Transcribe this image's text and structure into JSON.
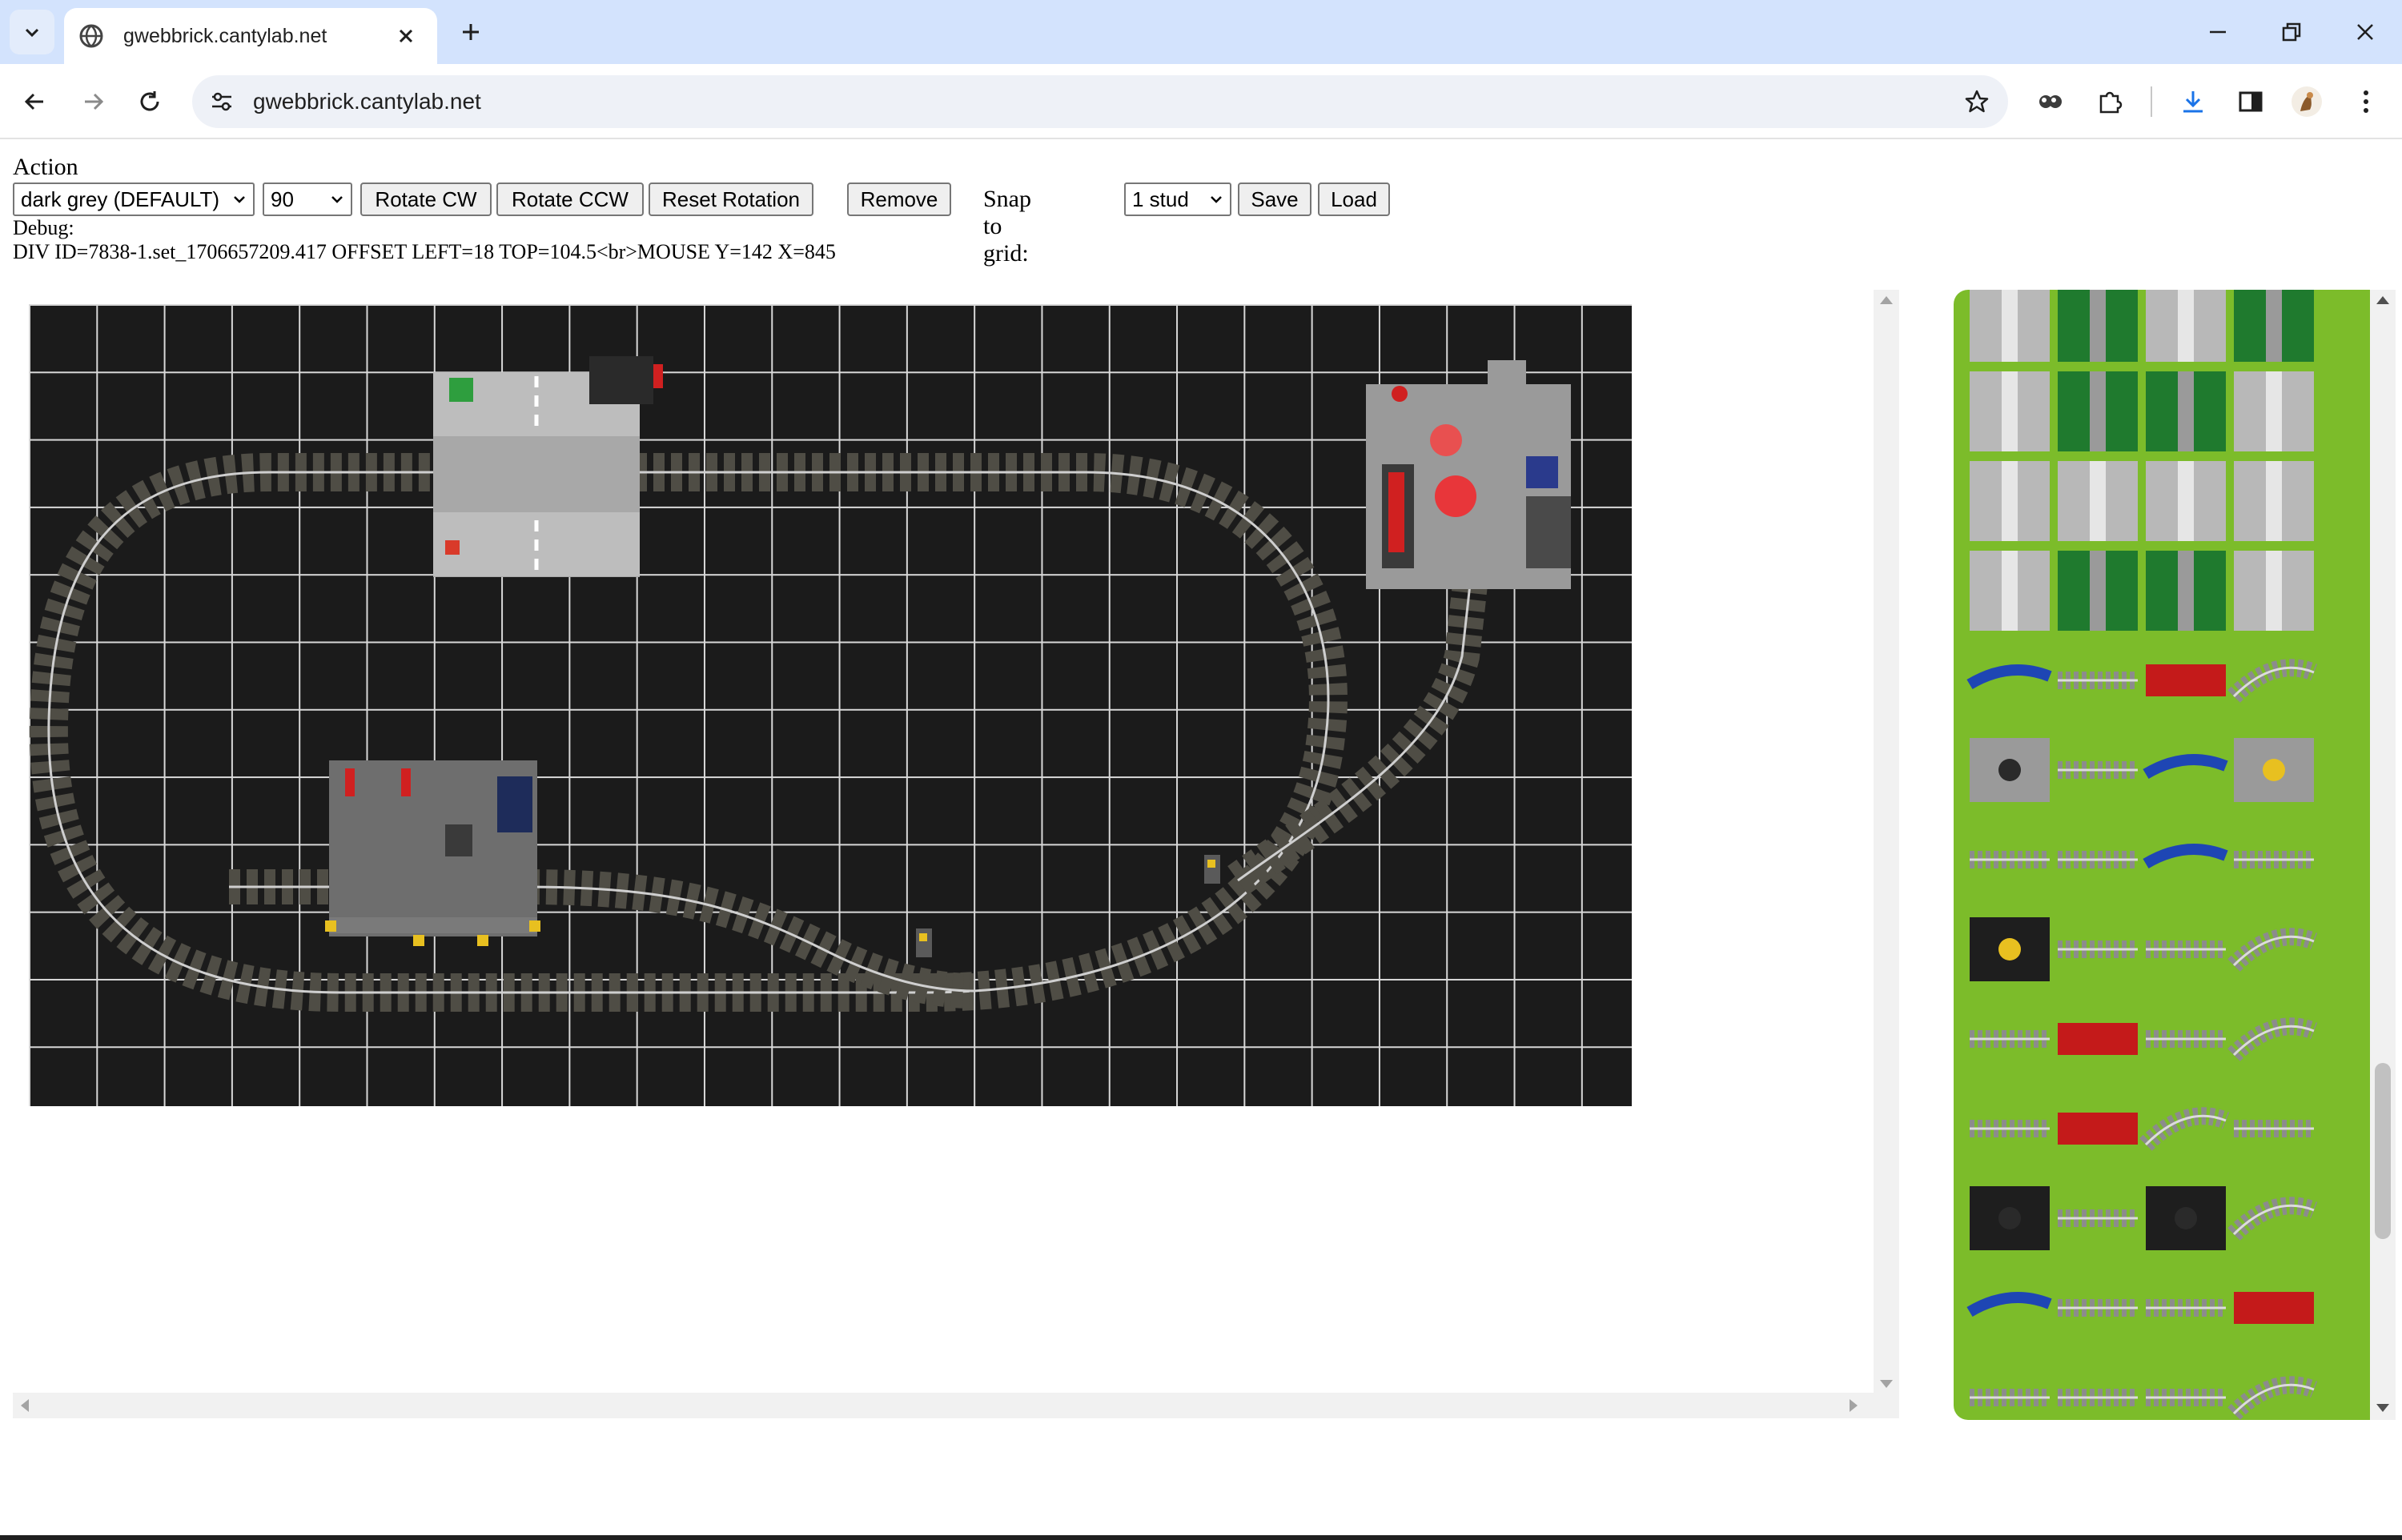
{
  "browser": {
    "tab_title": "gwebbrick.cantylab.net",
    "url": "gwebbrick.cantylab.net"
  },
  "page": {
    "action_label": "Action",
    "color_select_value": "dark grey (DEFAULT)",
    "angle_select_value": "90",
    "rotate_cw_label": "Rotate CW",
    "rotate_ccw_label": "Rotate CCW",
    "reset_rotation_label": "Reset Rotation",
    "remove_label": "Remove",
    "snap_label": "Snap to grid:",
    "snap_select_value": "1 stud",
    "save_label": "Save",
    "load_label": "Load",
    "debug_label": "Debug:",
    "debug_text": "DIV ID=7838-1.set_1706657209.417 OFFSET LEFT=18 TOP=104.5<br>MOUSE Y=142 X=845"
  },
  "colors": {
    "board": "#1b1b1b",
    "grid_line": "#d8d8d8",
    "track": "#5a5850",
    "rail": "#c8c8c8",
    "palette_bg": "#7cbc2a"
  },
  "palette": {
    "tiles": [
      "road-plate-crossing",
      "road-plate-green-t",
      "road-plate-junction",
      "road-plate-green-fork",
      "road-plate-straight",
      "road-plate-green-split",
      "road-plate-green-parking",
      "road-plate-roundabout",
      "road-plate-lane",
      "road-plate-ramp",
      "road-plate-short",
      "road-plate-straight-grey",
      "road-plate-curve",
      "road-plate-green-diagonal",
      "road-plate-green-straight",
      "road-plate-numbered",
      "track-blue-cross",
      "track-grey-straight",
      "track-red-bridge",
      "track-curve-grey",
      "platform-grey",
      "track-cross",
      "track-blue-curve",
      "signal-yellow-plate",
      "track-switch-left",
      "track-straight",
      "track-blue-curve-2",
      "track-switch-right",
      "engine-yellow-circle",
      "track-station",
      "track-connector",
      "track-curve",
      "track-buffer",
      "track-red-girder",
      "track-grid",
      "track-curve-2",
      "track-thin",
      "signal-red-green",
      "track-flex",
      "track-thin-2",
      "signal-black-white",
      "track-straight-2",
      "track-black-plate",
      "track-curve-3",
      "track-blue-straight",
      "track-dark-cross",
      "track-switch-thin",
      "track-blue-red-crossing",
      "track-ramp",
      "track-dark-straight",
      "track-switch-3",
      "track-arc",
      "track-thin-3",
      "track-flex-2",
      "track-red-bridge-2",
      "track-red-bridge-3"
    ]
  }
}
